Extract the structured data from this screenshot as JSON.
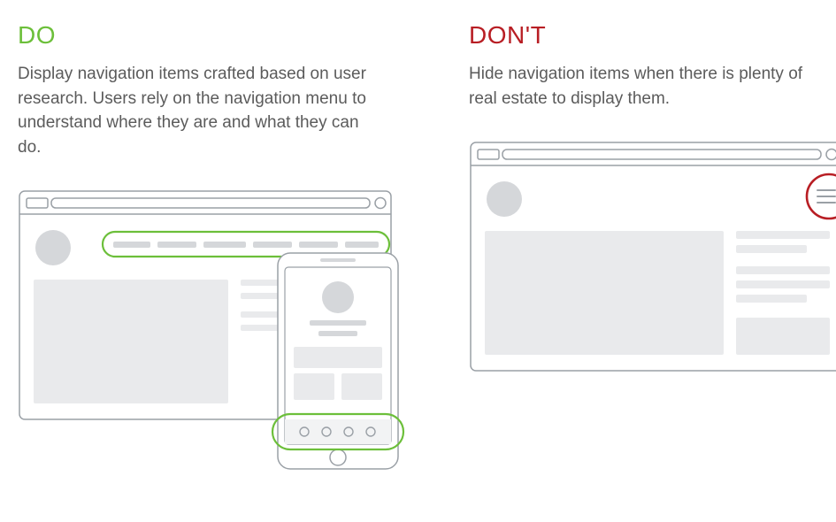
{
  "do": {
    "heading": "DO",
    "body": "Display navigation items crafted based on user research. Users rely on the navigation menu to understand where they are and what they can do."
  },
  "dont": {
    "heading": "DON'T",
    "body": "Hide navigation items when there is plenty of real estate to display them."
  },
  "colors": {
    "do_accent": "#6cbf3a",
    "dont_accent": "#b81e24",
    "wire_stroke": "#9aa0a6",
    "wire_fill": "#d5d7da"
  }
}
